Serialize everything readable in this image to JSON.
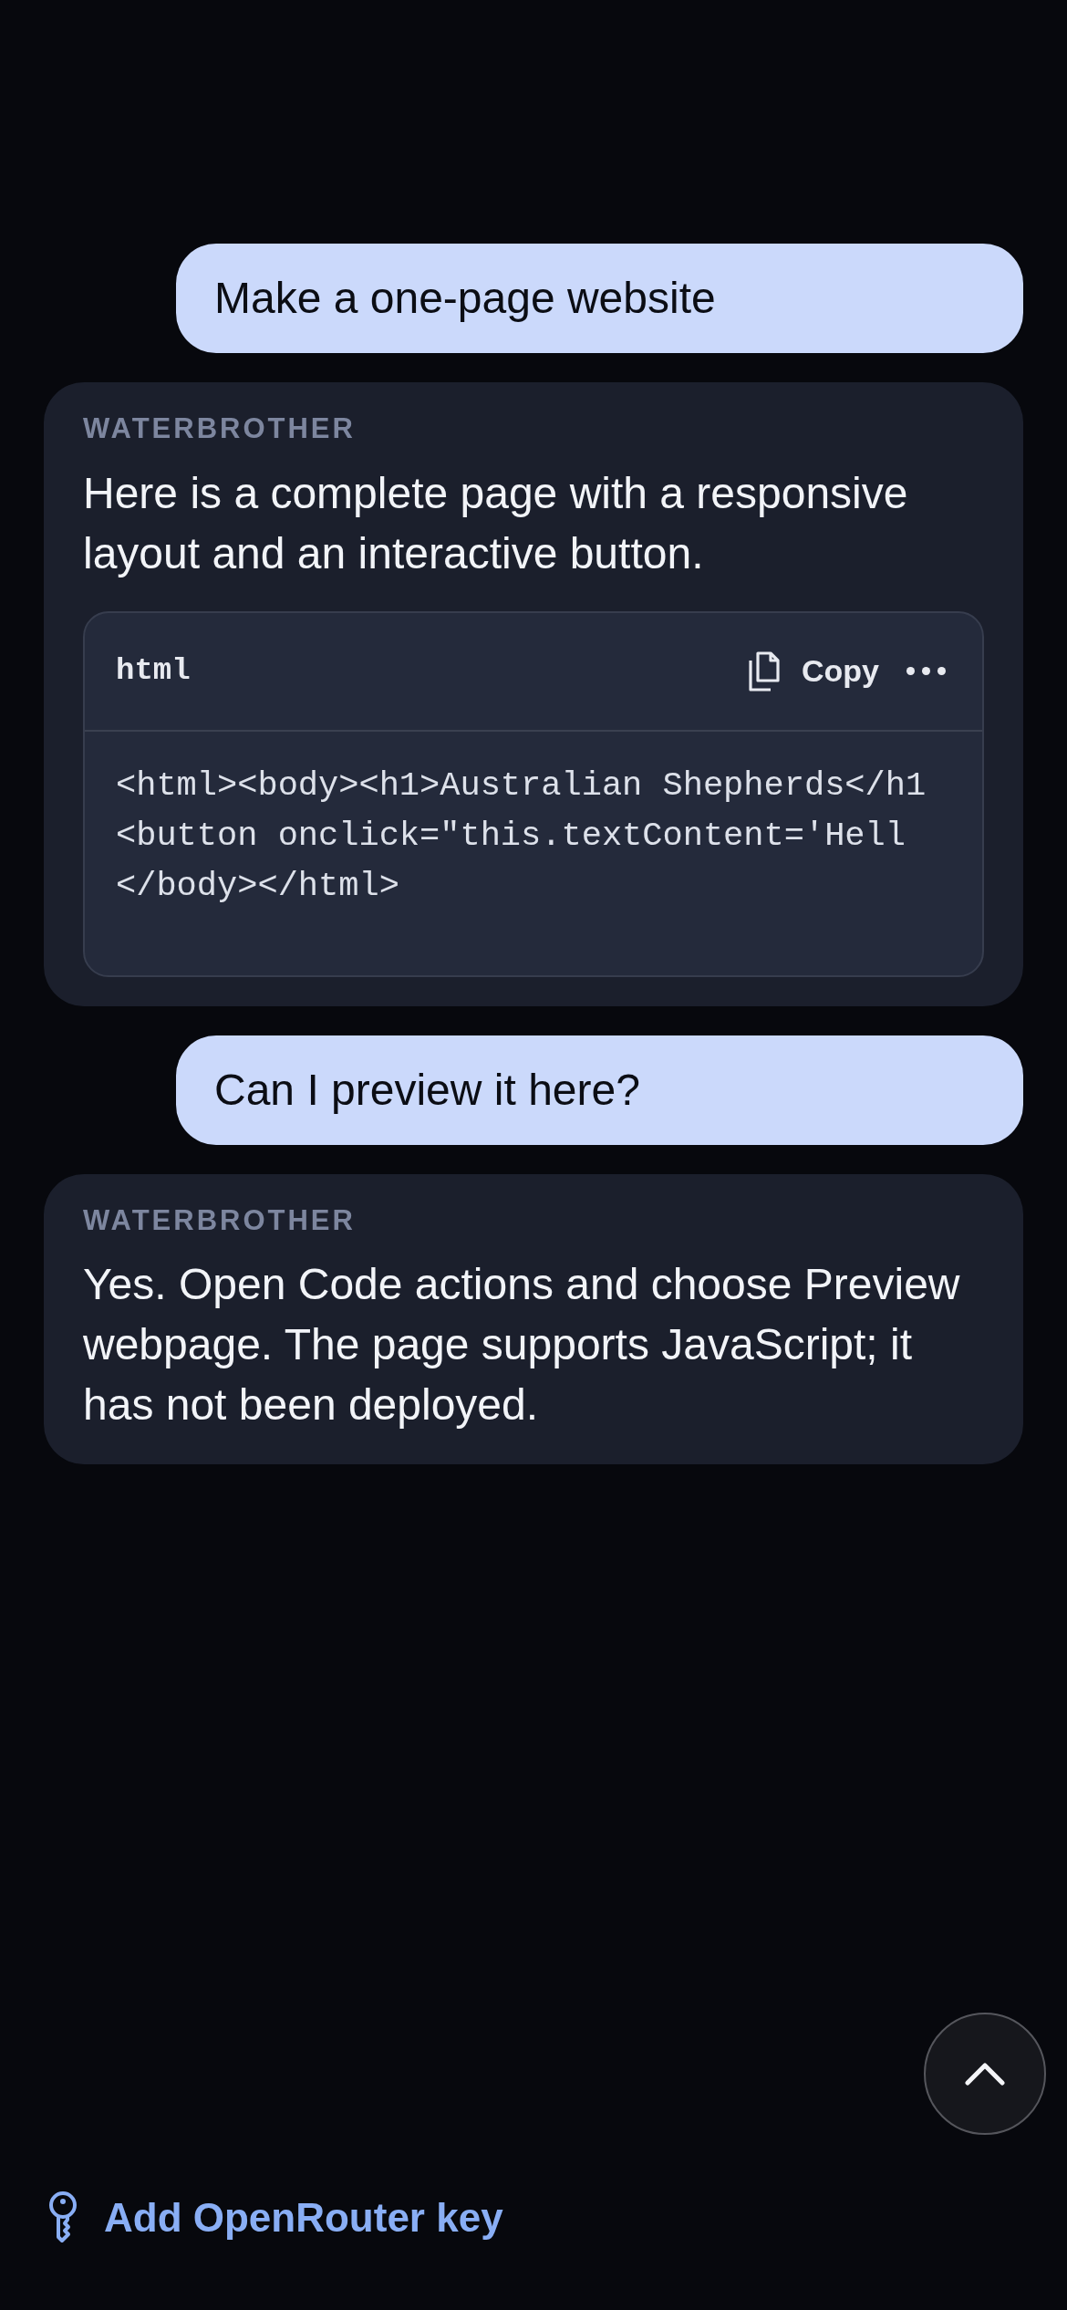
{
  "messages": [
    {
      "kind": "user",
      "text": "Make a one-page website"
    },
    {
      "kind": "assistant",
      "sender": "WATERBROTHER",
      "text": "Here is a complete page with a responsive layout and an interactive button.",
      "code": {
        "language": "html",
        "copy_label": "Copy",
        "lines": [
          "<html><body><h1>Australian Shepherds</h1",
          "<button onclick=\"this.textContent='Hell",
          "</body></html>"
        ]
      }
    },
    {
      "kind": "user",
      "text": "Can I preview it here?"
    },
    {
      "kind": "assistant",
      "sender": "WATERBROTHER",
      "text": "Yes. Open Code actions and choose Preview webpage. The page supports JavaScript; it has not been deployed."
    }
  ],
  "footer": {
    "link": "Add OpenRouter key"
  }
}
